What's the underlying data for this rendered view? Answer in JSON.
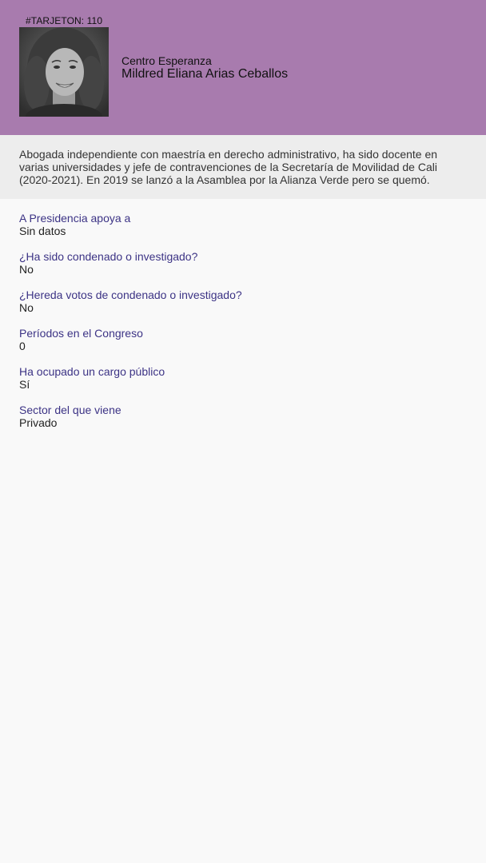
{
  "header": {
    "tarjeton": "#TARJETON: 110",
    "party": "Centro Esperanza",
    "candidate_name": "Mildred Eliana Arias Ceballos",
    "background_color": "#a87bae"
  },
  "bio": "Abogada independiente con maestría en derecho administrativo, ha sido docente en varias universidades y jefe de contravenciones de la Secretaría de Movilidad de Cali (2020-2021). En 2019 se lanzó a la Asamblea por la Alianza Verde pero se quemó.",
  "fields": [
    {
      "label": "A Presidencia apoya a",
      "value": "Sin datos"
    },
    {
      "label": "¿Ha sido condenado o investigado?",
      "value": "No"
    },
    {
      "label": "¿Hereda votos de condenado o investigado?",
      "value": "No"
    },
    {
      "label": "Períodos en el Congreso",
      "value": "0"
    },
    {
      "label": "Ha ocupado un cargo público",
      "value": "Sí"
    },
    {
      "label": "Sector del que viene",
      "value": "Privado"
    }
  ],
  "colors": {
    "label": "#3c3385",
    "bio_background": "#ededed",
    "page_background": "#f9f9f9"
  }
}
